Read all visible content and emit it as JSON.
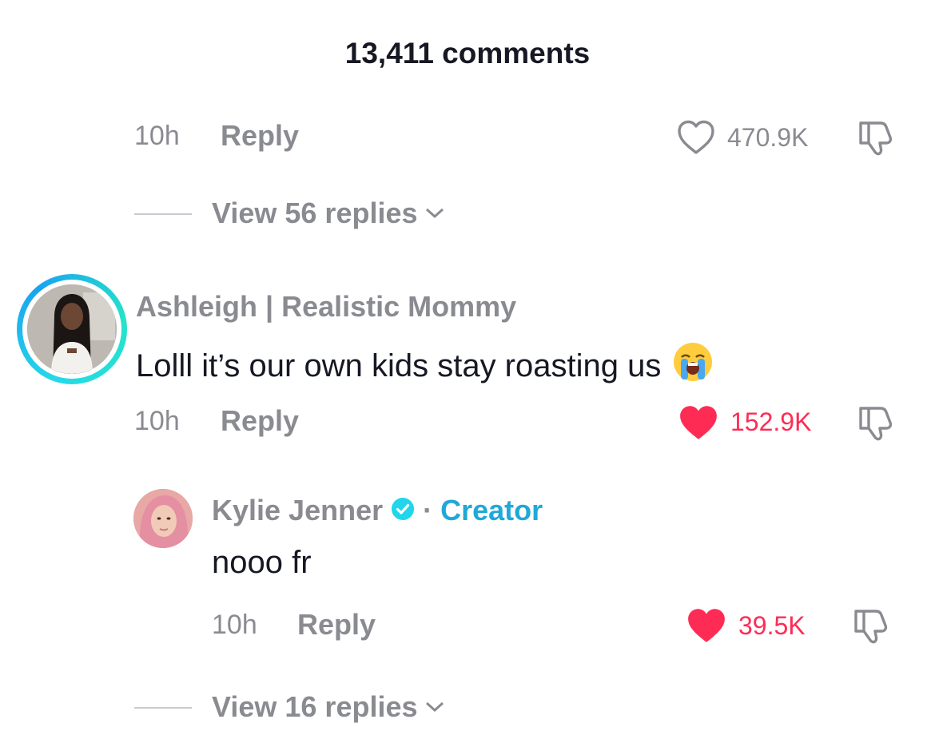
{
  "header": {
    "title": "13,411 comments"
  },
  "comments": [
    {
      "time": "10h",
      "reply_label": "Reply",
      "likes": "470.9K",
      "liked": false,
      "view_replies": "View 56 replies"
    },
    {
      "username": "Ashleigh | Realistic Mommy",
      "text": "Lolll it’s our own kids stay roasting us",
      "emoji": "😭",
      "time": "10h",
      "reply_label": "Reply",
      "likes": "152.9K",
      "liked": true,
      "replies": [
        {
          "username": "Kylie Jenner",
          "verified": true,
          "separator": "·",
          "badge": "Creator",
          "text": "nooo fr",
          "time": "10h",
          "reply_label": "Reply",
          "likes": "39.5K",
          "liked": true
        }
      ],
      "view_replies": "View 16 replies"
    }
  ],
  "colors": {
    "like_active": "#fe2c55",
    "muted_text": "#8a8b91",
    "creator_accent": "#20a8d8",
    "verified_badge": "#20d5ec"
  },
  "icons": [
    "heart-outline-icon",
    "heart-filled-icon",
    "dislike-icon",
    "chevron-down-icon",
    "verified-icon"
  ]
}
